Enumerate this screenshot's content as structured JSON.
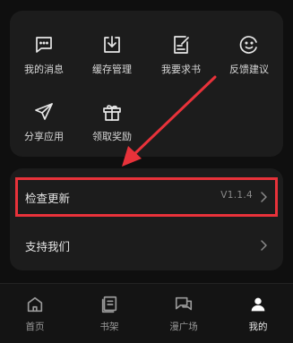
{
  "grid_items": [
    {
      "label": "我的消息",
      "icon": "message-icon"
    },
    {
      "label": "缓存管理",
      "icon": "download-box-icon"
    },
    {
      "label": "我要求书",
      "icon": "edit-document-icon"
    },
    {
      "label": "反馈建议",
      "icon": "smiley-icon"
    },
    {
      "label": "分享应用",
      "icon": "send-icon"
    },
    {
      "label": "领取奖励",
      "icon": "gift-icon"
    }
  ],
  "settings": {
    "check_update": {
      "label": "检查更新",
      "value": "V1.1.4"
    },
    "support_us": {
      "label": "支持我们"
    }
  },
  "tabs": [
    {
      "label": "首页",
      "icon": "home-icon"
    },
    {
      "label": "书架",
      "icon": "bookshelf-icon"
    },
    {
      "label": "漫广场",
      "icon": "chat-bubbles-icon"
    },
    {
      "label": "我的",
      "icon": "user-icon"
    }
  ],
  "colors": {
    "annotation_red": "#e8323a",
    "background": "#0f0f0f",
    "card": "#1c1c1c",
    "active_tab_bg": "#3a2b2b"
  }
}
